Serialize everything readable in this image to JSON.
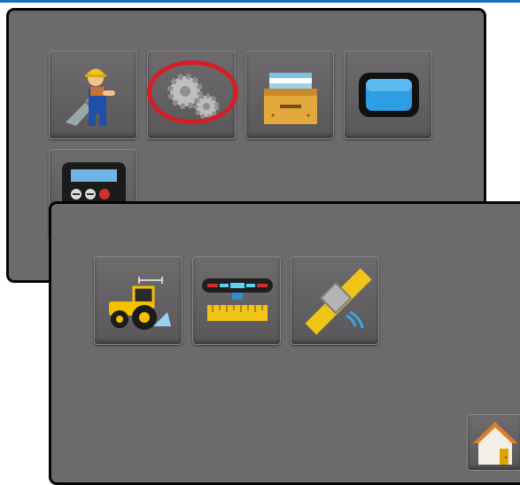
{
  "screen": {
    "top_menu": {
      "items": [
        {
          "icon": "operator-worker-icon"
        },
        {
          "icon": "gears-icon"
        },
        {
          "icon": "file-box-icon"
        },
        {
          "icon": "display-screen-icon"
        },
        {
          "icon": "calculator-icon"
        }
      ],
      "selected_icon": "gears-icon",
      "highlight_color": "#d41e25"
    },
    "sub_menu": {
      "items": [
        {
          "icon": "tractor-setup-icon"
        },
        {
          "icon": "boom-sections-icon"
        },
        {
          "icon": "gnss-satellite-icon"
        }
      ],
      "home_icon": "home-icon"
    }
  }
}
